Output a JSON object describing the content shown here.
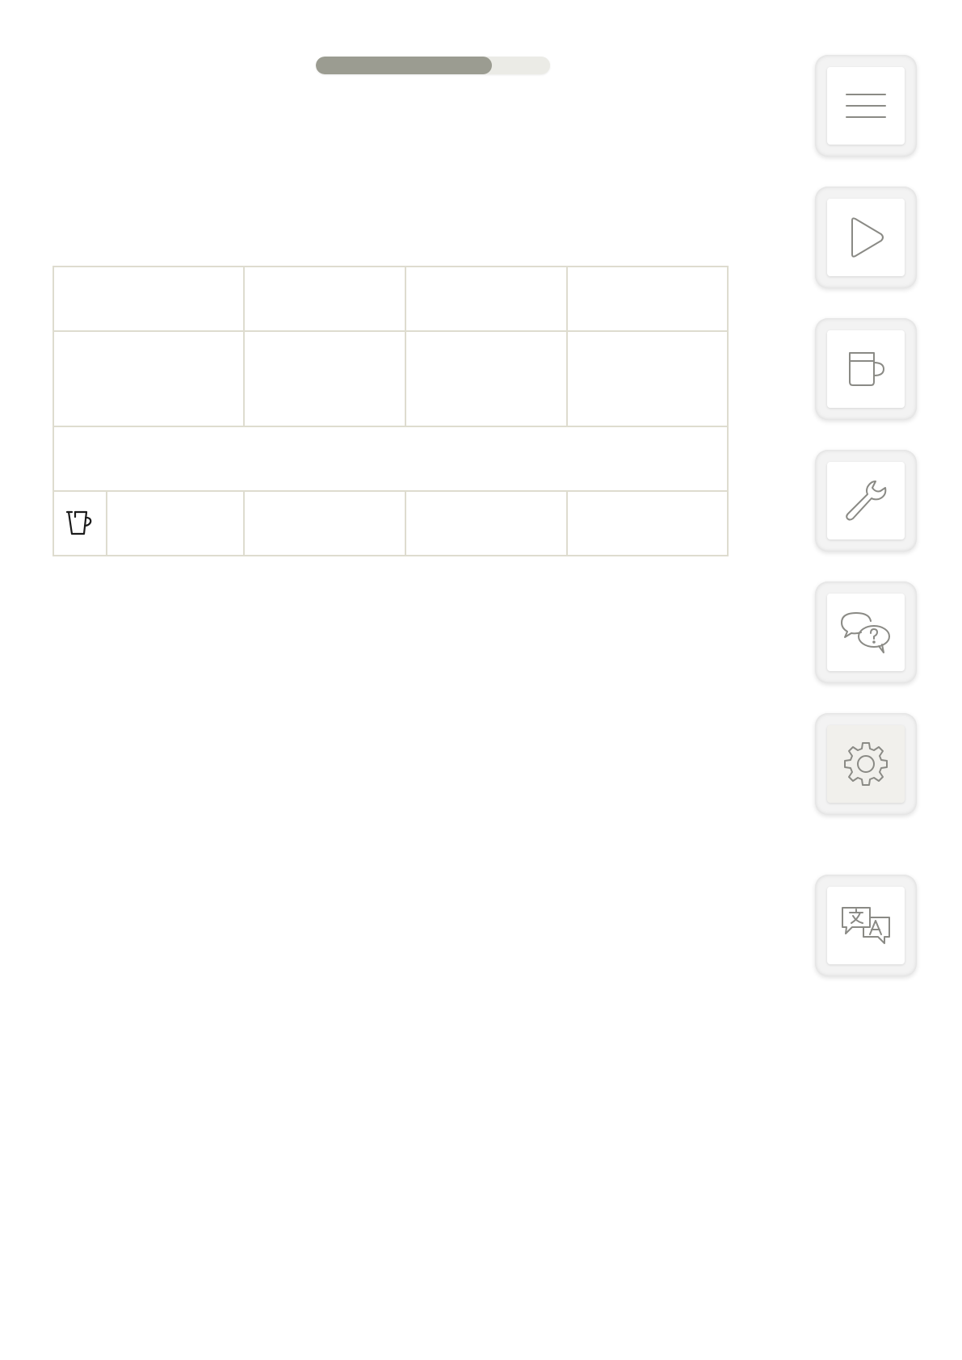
{
  "progress": {
    "fraction": 0.75
  },
  "table": {
    "rows": [
      {
        "cells": [
          "",
          "",
          "",
          ""
        ]
      },
      {
        "cells": [
          "",
          "",
          "",
          ""
        ]
      },
      {
        "merged": ""
      },
      {
        "icon": "cup-icon",
        "cells": [
          "",
          "",
          "",
          ""
        ]
      }
    ]
  },
  "sidebar": {
    "buttons": [
      {
        "icon": "menu-icon",
        "active": false
      },
      {
        "icon": "play-icon",
        "active": false
      },
      {
        "icon": "mug-icon",
        "active": false
      },
      {
        "icon": "wrench-icon",
        "active": false
      },
      {
        "icon": "help-chat-icon",
        "active": false
      },
      {
        "icon": "gear-icon",
        "active": true
      },
      {
        "icon": "translate-icon",
        "active": false
      }
    ]
  },
  "colors": {
    "progress_fill": "#9b9c91",
    "progress_track": "#ebebe6",
    "table_border": "#dedccf",
    "icon_stroke": "#8a8a85",
    "active_button_face": "#f1f0ec"
  }
}
